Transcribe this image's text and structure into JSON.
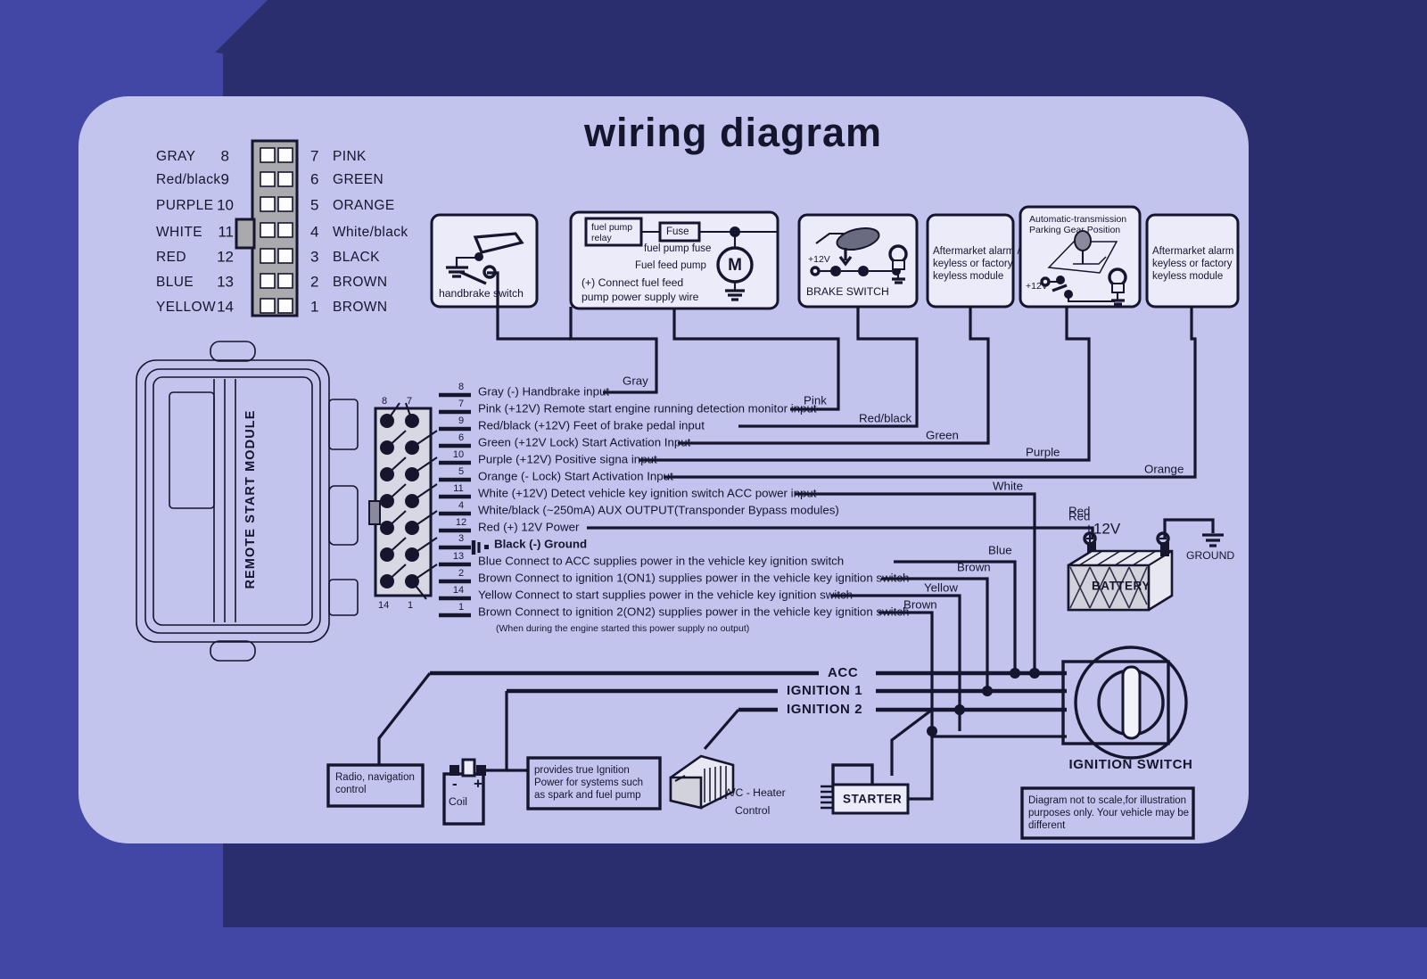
{
  "title": "wiring  diagram",
  "colors": {
    "bg_dark": "#2a2d6e",
    "bg_light": "#4246a4",
    "card": "#c3c4ee",
    "ink": "#15152e",
    "box_fill": "#ecebfa",
    "connector_body": "#a9a9ae"
  },
  "pinout_legend": {
    "left_column": [
      {
        "color": "GRAY",
        "pin": "8"
      },
      {
        "color": "Red/black",
        "pin": "9"
      },
      {
        "color": "PURPLE",
        "pin": "10"
      },
      {
        "color": "WHITE",
        "pin": "11"
      },
      {
        "color": "RED",
        "pin": "12"
      },
      {
        "color": "BLUE",
        "pin": "13"
      },
      {
        "color": "YELLOW",
        "pin": "14"
      }
    ],
    "right_column": [
      {
        "pin": "7",
        "color": "PINK"
      },
      {
        "pin": "6",
        "color": "GREEN"
      },
      {
        "pin": "5",
        "color": "ORANGE"
      },
      {
        "pin": "4",
        "color": "White/black"
      },
      {
        "pin": "3",
        "color": "BLACK"
      },
      {
        "pin": "2",
        "color": "BROWN"
      },
      {
        "pin": "1",
        "color": "BROWN"
      }
    ]
  },
  "module": {
    "label": "REMOTE START MODULE",
    "connector_top_left_pin": "8",
    "connector_top_right_pin": "7",
    "connector_bottom_left_pin": "14",
    "connector_bottom_right_pin": "1"
  },
  "top_boxes": [
    {
      "id": "handbrake",
      "caption": "handbrake  switch"
    },
    {
      "id": "fuel-pump",
      "relay_label": "fuel pump\nrelay",
      "relay_line1": "fuel pump",
      "relay_line2": "relay",
      "fuse_label": "Fuse",
      "fuse_caption": "fuel pump fuse",
      "pump_caption": "Fuel  feed  pump",
      "motor_label": "M",
      "note_line1": "(+) Connect fuel feed",
      "note_line2": "pump power supply wire"
    },
    {
      "id": "brake-switch",
      "voltage": "+12V",
      "caption": "BRAKE  SWITCH"
    },
    {
      "id": "aftermarket-1",
      "line1": "Aftermarket alarm /",
      "line2": "keyless or factory",
      "line3": "keyless module"
    },
    {
      "id": "parking-gear",
      "title_line1": "Automatic-transmission",
      "title_line2": "Parking Gear Position",
      "voltage": "+12V"
    },
    {
      "id": "aftermarket-2",
      "line1": "Aftermarket alarm /",
      "line2": "keyless or factory",
      "line3": "keyless module"
    }
  ],
  "wire_rows": [
    {
      "pin": "8",
      "text": "Gray  (-) Handbrake input",
      "tag": "Gray",
      "bold": false
    },
    {
      "pin": "7",
      "text": "Pink (+12V) Remote start engine running detection monitor input",
      "tag": "Pink",
      "bold": false
    },
    {
      "pin": "9",
      "text": "Red/black  (+12V) Feet of brake pedal input",
      "tag": "Red/black",
      "bold": false
    },
    {
      "pin": "6",
      "text": "Green (+12V Lock) Start Activation Input",
      "tag": "Green",
      "bold": false
    },
    {
      "pin": "10",
      "text": "Purple  (+12V) Positive signa input",
      "tag": "Purple",
      "bold": false
    },
    {
      "pin": "5",
      "text": "Orange  (- Lock)  Start Activation Input",
      "tag": "Orange",
      "bold": false
    },
    {
      "pin": "11",
      "text": "White  (+12V) Detect vehicle key ignition switch ACC power input",
      "tag": "White",
      "bold": false
    },
    {
      "pin": "4",
      "text": "White/black (~250mA) AUX OUTPUT(Transponder Bypass modules)",
      "tag": "",
      "bold": false
    },
    {
      "pin": "12",
      "text": "Red  (+) 12V Power",
      "tag": "Red",
      "bold": false
    },
    {
      "pin": "3",
      "text": "Black  (-) Ground",
      "tag": "",
      "bold": true
    },
    {
      "pin": "13",
      "text": "Blue  Connect to ACC supplies power in the vehicle key ignition switch",
      "tag": "Blue",
      "bold": false
    },
    {
      "pin": "2",
      "text": "Brown  Connect to ignition 1(ON1) supplies power in the vehicle key ignition switch",
      "tag": "Brown",
      "bold": false
    },
    {
      "pin": "14",
      "text": "Yellow  Connect to start supplies power in the vehicle key ignition switch",
      "tag": "Yellow",
      "bold": false
    },
    {
      "pin": "1",
      "text": "Brown  Connect to ignition 2(ON2) supplies power in the vehicle key ignition switch",
      "tag": "Brown",
      "bold": false
    }
  ],
  "wire_note": "(When during the engine started this power supply no output)",
  "battery": {
    "plus_label": "+12V",
    "red_label": "Red",
    "name": "BATTERY",
    "ground_label": "GROUND"
  },
  "bus_labels": [
    "ACC",
    "IGNITION 1",
    "IGNITION 2"
  ],
  "ignition_switch": {
    "label": "IGNITION SWITCH"
  },
  "bottom_boxes": {
    "radio": {
      "line1": "Radio, navigation",
      "line2": "control"
    },
    "coil": {
      "label": "Coil",
      "minus": "-",
      "plus": "+"
    },
    "true_ignition": {
      "line1": "provides true Ignition",
      "line2": "Power for systems such",
      "line3": "as spark and fuel pump"
    },
    "ac_heater": {
      "line1": "A/C - Heater",
      "line2": "Control"
    },
    "starter": {
      "label": "STARTER"
    },
    "disclaimer": {
      "line1": "Diagram not to scale,for illustration",
      "line2": "purposes only. Your vehicle may be",
      "line3": "different"
    }
  }
}
